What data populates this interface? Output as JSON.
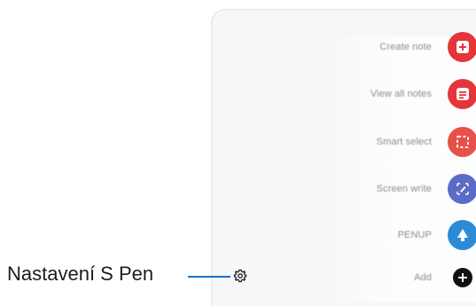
{
  "callout": {
    "label": "Nastavení S Pen"
  },
  "settings": {
    "icon": "gear-icon"
  },
  "menu": {
    "items": [
      {
        "label": "Create note",
        "icon": "plus-square-icon",
        "color": "#e4353a"
      },
      {
        "label": "View all notes",
        "icon": "note-list-icon",
        "color": "#e4353a"
      },
      {
        "label": "Smart select",
        "icon": "dashed-select-icon",
        "color": "#e8504a"
      },
      {
        "label": "Screen write",
        "icon": "pen-write-icon",
        "color": "#5b6bc6"
      },
      {
        "label": "PENUP",
        "icon": "penup-icon",
        "color": "#2c8ad6"
      },
      {
        "label": "Add",
        "icon": "plus-icon",
        "color": "#111111"
      }
    ]
  },
  "colors": {
    "callout_line": "#1673c5",
    "panel_bg": "#f6f7f9"
  }
}
